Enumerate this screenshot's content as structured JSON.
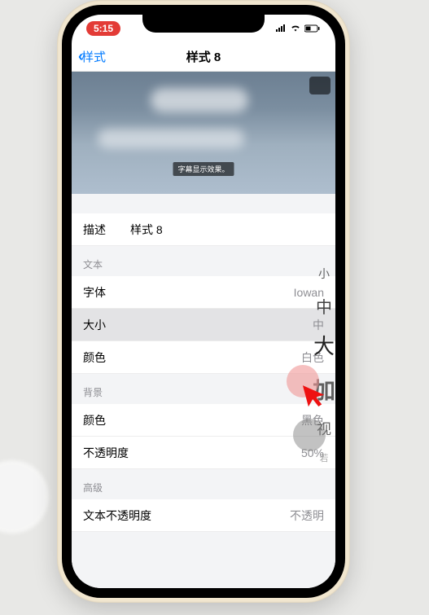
{
  "status": {
    "time": "5:15"
  },
  "nav": {
    "back": "样式",
    "title": "样式 8"
  },
  "preview": {
    "subtitle_sample": "字幕显示效果。"
  },
  "desc": {
    "label": "描述",
    "value": "样式 8"
  },
  "sections": {
    "text": {
      "header": "文本",
      "font": {
        "label": "字体",
        "value": "Iowan"
      },
      "size": {
        "label": "大小",
        "value": "中"
      },
      "color": {
        "label": "颜色",
        "value": "白色"
      }
    },
    "background": {
      "header": "背景",
      "color": {
        "label": "颜色",
        "value": "黑色"
      },
      "opacity": {
        "label": "不透明度",
        "value": "50%"
      }
    },
    "advanced": {
      "header": "高级",
      "text_opacity": {
        "label": "文本不透明度",
        "value": "不透明"
      }
    }
  },
  "picker": {
    "options": [
      "小",
      "中",
      "大",
      "加",
      "视",
      "若"
    ]
  }
}
